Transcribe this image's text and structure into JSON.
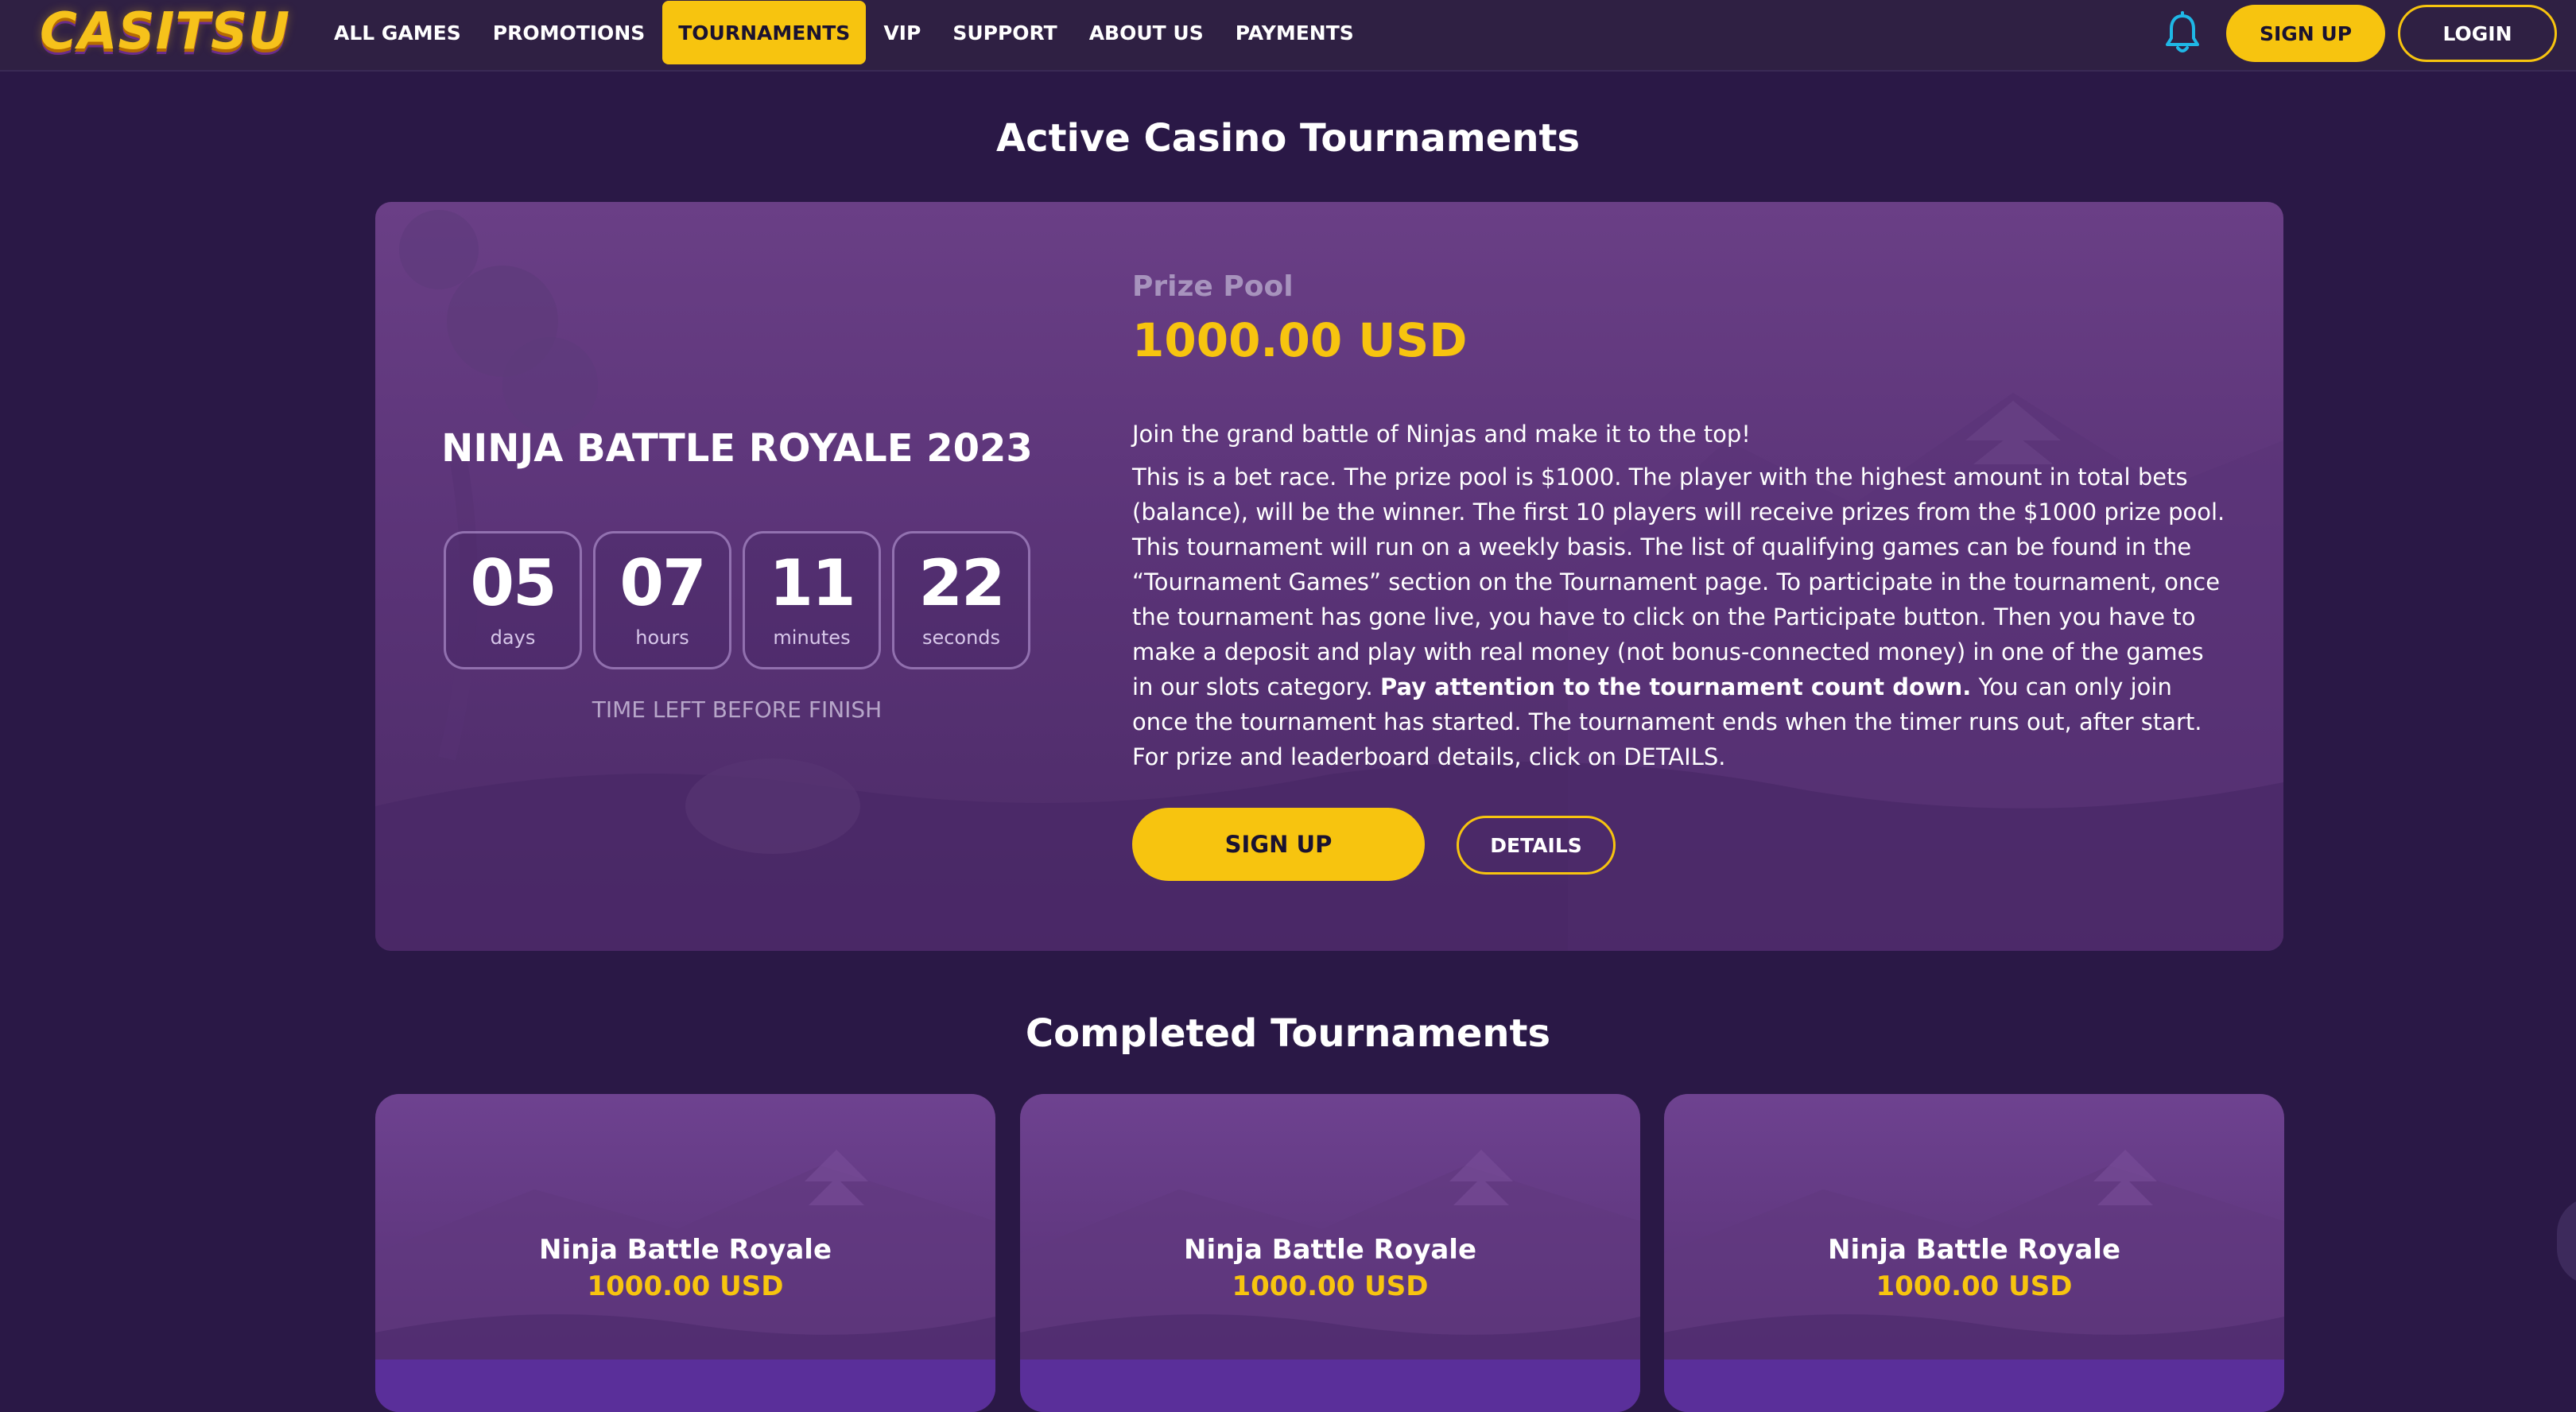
{
  "header": {
    "logo_text": "CASITSU",
    "nav": [
      {
        "label": "ALL GAMES",
        "active": false
      },
      {
        "label": "PROMOTIONS",
        "active": false
      },
      {
        "label": "TOURNAMENTS",
        "active": true
      },
      {
        "label": "VIP",
        "active": false
      },
      {
        "label": "SUPPORT",
        "active": false
      },
      {
        "label": "ABOUT US",
        "active": false
      },
      {
        "label": "PAYMENTS",
        "active": false
      }
    ],
    "notification_icon": "bell-icon",
    "signup_label": "SIGN UP",
    "login_label": "LOGIN"
  },
  "active_section": {
    "title": "Active Casino Tournaments",
    "tournament": {
      "name": "NINJA BATTLE ROYALE 2023",
      "countdown": [
        {
          "value": "05",
          "unit": "days"
        },
        {
          "value": "07",
          "unit": "hours"
        },
        {
          "value": "11",
          "unit": "minutes"
        },
        {
          "value": "22",
          "unit": "seconds"
        }
      ],
      "time_left_label": "TIME LEFT BEFORE FINISH",
      "prize_label": "Prize Pool",
      "prize_value": "1000.00 USD",
      "intro": "Join the grand battle of Ninjas and make it to the top!",
      "body_1": "This is a bet race. The prize pool is $1000. The player with the highest amount in total bets (balance), will be the winner. The first 10 players will receive prizes from the $1000 prize pool. This tournament will run on a weekly basis. The list of qualifying games can be found in the “Tournament Games” section on the Tournament page. To participate in the tournament, once the tournament has gone live, you have to click on the Participate button. Then you have to make a deposit and play with real money (not bonus-connected money) in one of the games in our slots category. ",
      "body_bold": "Pay attention to the tournament count down.",
      "body_2": " You can only join once the tournament has started. The tournament ends when the timer runs out, after start. For prize and leaderboard details, click on DETAILS.",
      "signup_label": "SIGN UP",
      "details_label": "DETAILS"
    }
  },
  "completed_section": {
    "title": "Completed Tournaments",
    "cards": [
      {
        "name": "Ninja Battle Royale",
        "prize": "1000.00 USD"
      },
      {
        "name": "Ninja Battle Royale",
        "prize": "1000.00 USD"
      },
      {
        "name": "Ninja Battle Royale",
        "prize": "1000.00 USD"
      }
    ]
  },
  "colors": {
    "background": "#2a1846",
    "topbar": "#2f2043",
    "accent_yellow": "#f7c40f",
    "card_purple": "#5b3478"
  }
}
